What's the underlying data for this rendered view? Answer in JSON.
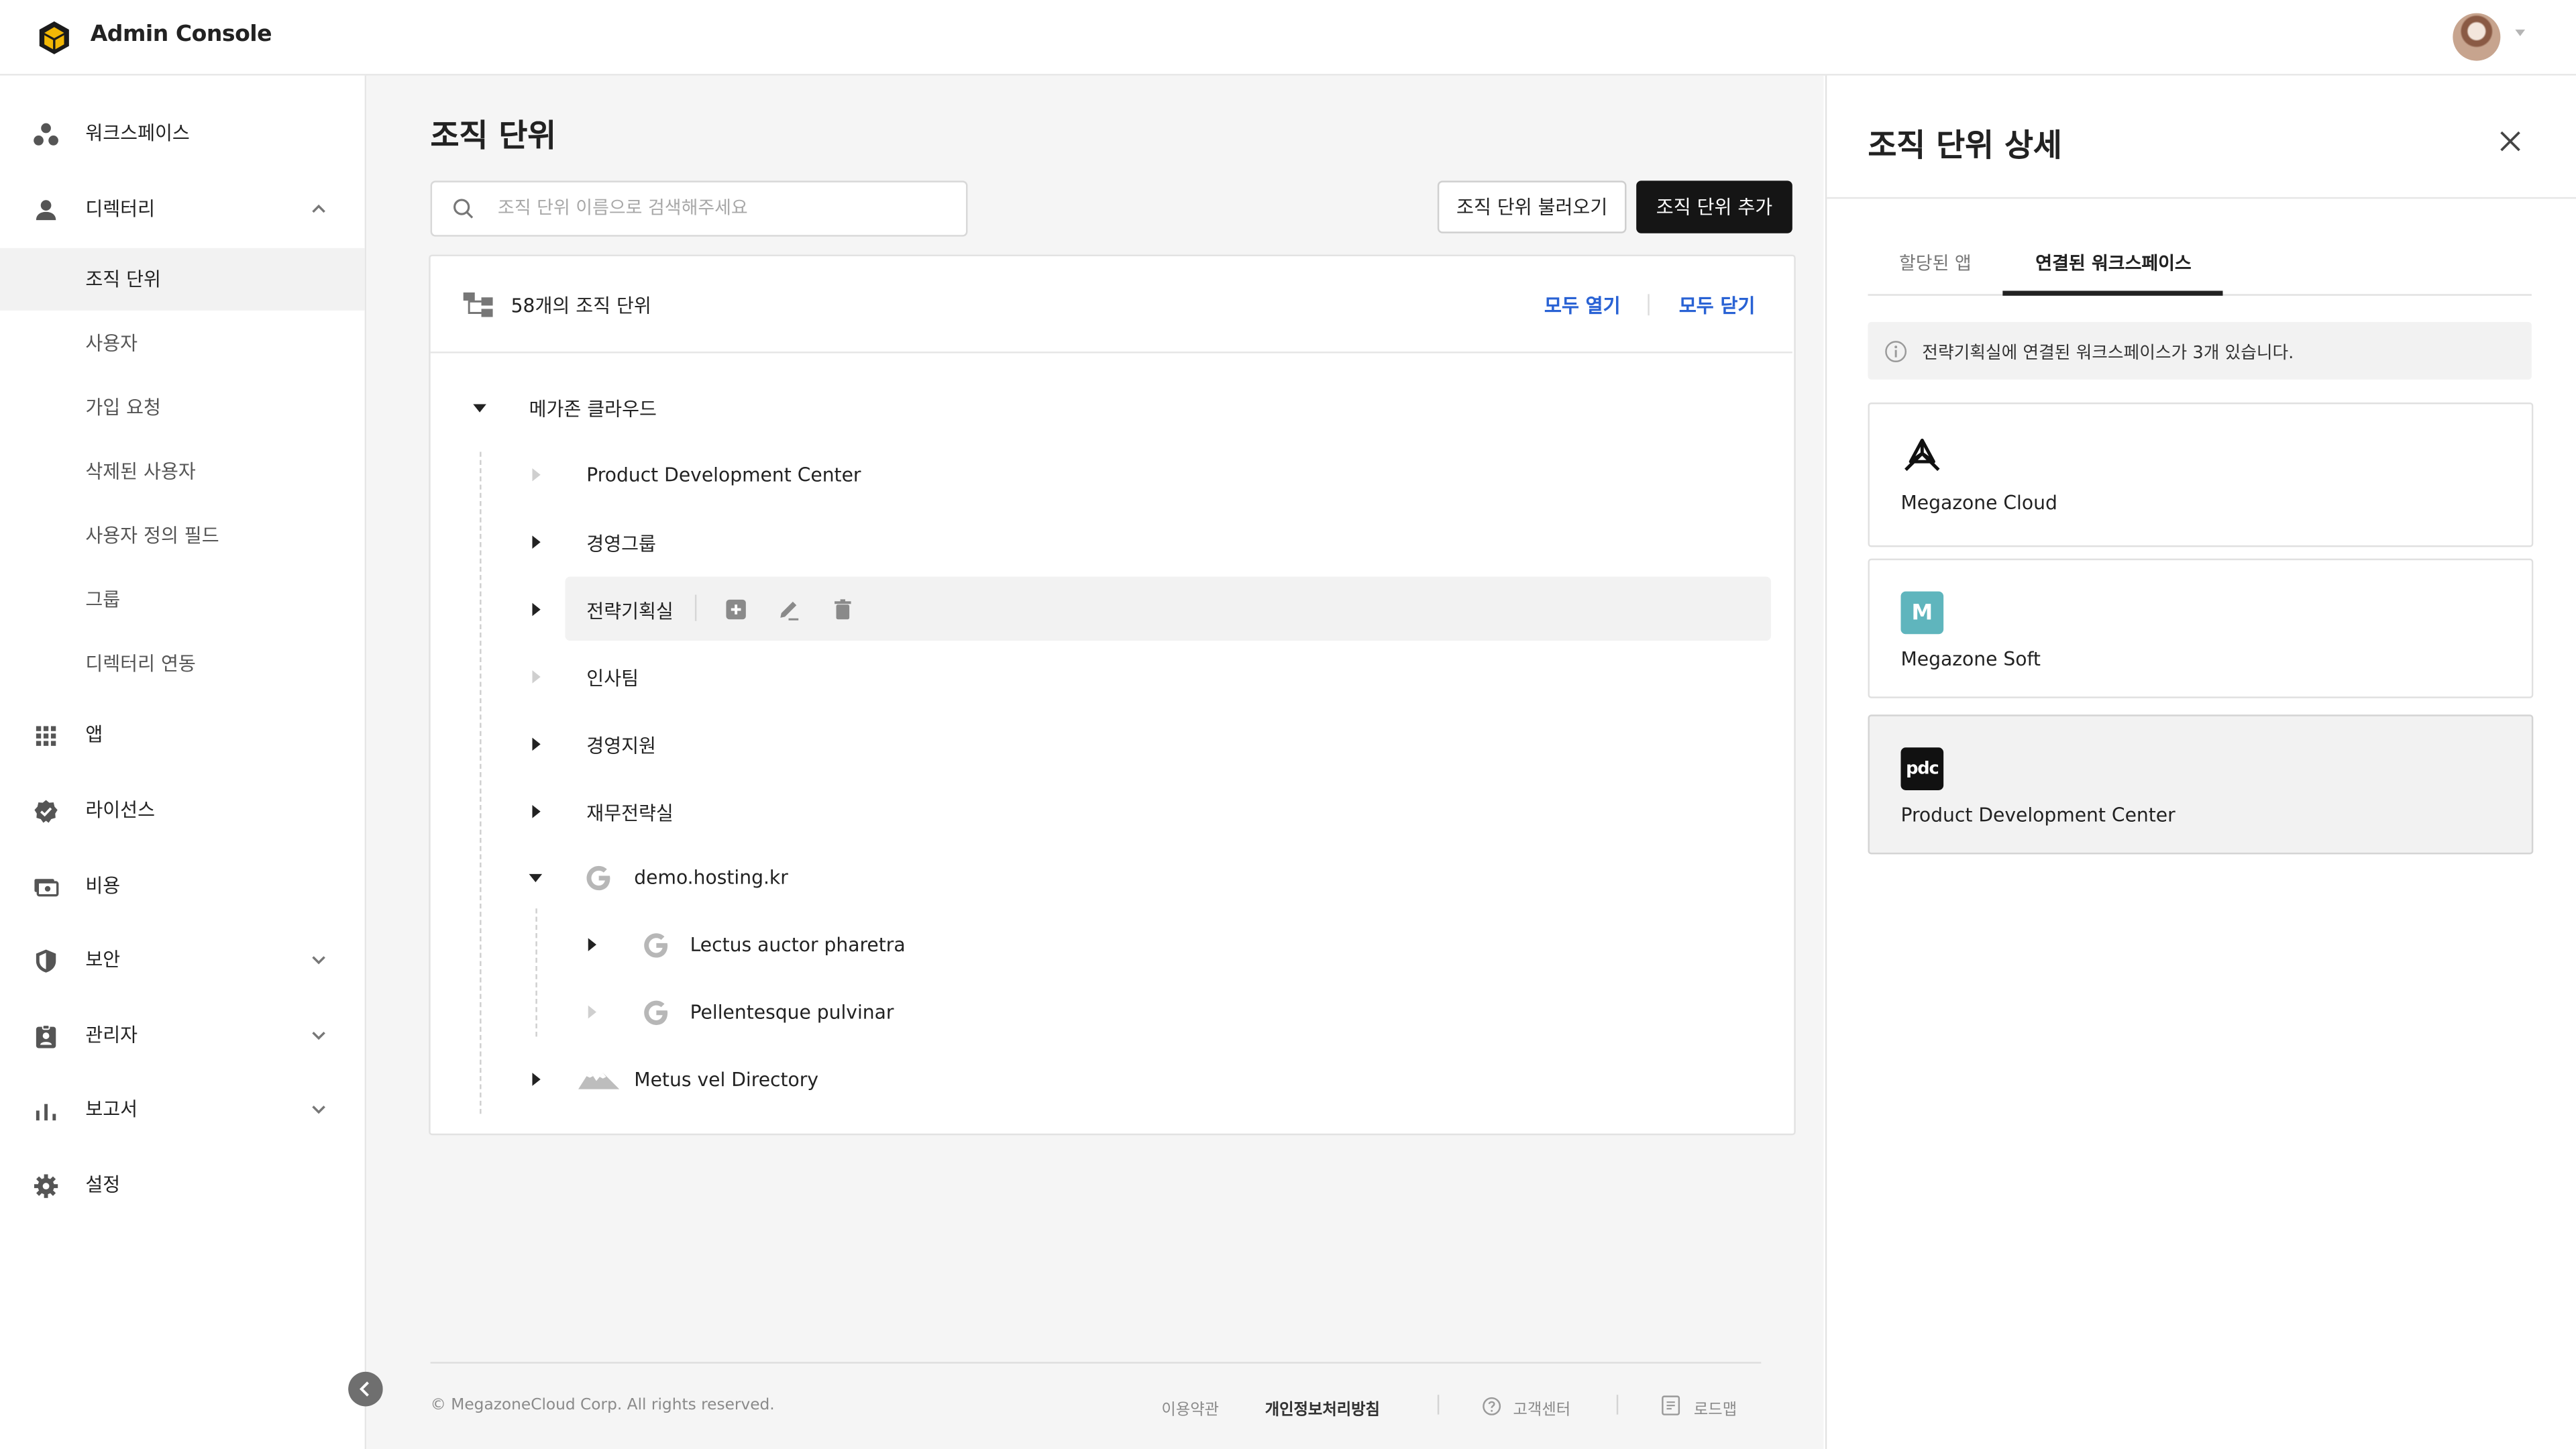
{
  "header": {
    "title": "Admin Console",
    "logo_icon": "megazone-cube-logo",
    "avatar_icon": "user-avatar"
  },
  "sidebar": {
    "items": [
      {
        "label": "워크스페이스",
        "icon": "workspace-icon"
      },
      {
        "label": "디렉터리",
        "icon": "person-icon",
        "expanded": true,
        "children": [
          "조직 단위",
          "사용자",
          "가입 요청",
          "삭제된 사용자",
          "사용자 정의 필드",
          "그룹",
          "디렉터리 연동"
        ],
        "active_child": "조직 단위"
      },
      {
        "label": "앱",
        "icon": "apps-grid-icon"
      },
      {
        "label": "라이선스",
        "icon": "badge-check-icon"
      },
      {
        "label": "비용",
        "icon": "billing-icon"
      },
      {
        "label": "보안",
        "icon": "shield-icon",
        "expandable": true
      },
      {
        "label": "관리자",
        "icon": "admin-id-icon",
        "expandable": true
      },
      {
        "label": "보고서",
        "icon": "bar-chart-icon",
        "expandable": true
      },
      {
        "label": "설정",
        "icon": "gear-icon"
      }
    ]
  },
  "main": {
    "title": "조직 단위",
    "search_placeholder": "조직 단위 이름으로 검색해주세요",
    "search_value": "",
    "import_button": "조직 단위 불러오기",
    "add_button": "조직 단위 추가",
    "tree": {
      "count_label": "58개의 조직 단위",
      "expand_all": "모두 열기",
      "collapse_all": "모두 닫기",
      "root": "메가존 클라우드",
      "nodes": [
        {
          "label": "Product Development Center",
          "has_children": false
        },
        {
          "label": "경영그룹",
          "has_children": true
        },
        {
          "label": "전략기획실",
          "has_children": true,
          "selected": true
        },
        {
          "label": "인사팀",
          "has_children": false
        },
        {
          "label": "경영지원",
          "has_children": true
        },
        {
          "label": "재무전략실",
          "has_children": true
        },
        {
          "label": "demo.hosting.kr",
          "has_children": true,
          "expanded": true,
          "icon": "google-icon",
          "children": [
            {
              "label": "Lectus auctor pharetra",
              "has_children": true,
              "icon": "google-icon"
            },
            {
              "label": "Pellentesque pulvinar",
              "has_children": false,
              "icon": "google-icon"
            }
          ]
        },
        {
          "label": "Metus vel Directory",
          "has_children": true,
          "icon": "mountain-directory-icon"
        }
      ]
    }
  },
  "footer": {
    "copyright": "© MegazoneCloud Corp. All rights reserved.",
    "terms": "이용약관",
    "privacy": "개인정보처리방침",
    "support": "고객센터",
    "roadmap": "로드맵"
  },
  "panel": {
    "title": "조직 단위 상세",
    "tabs": [
      "할당된 앱",
      "연결된 워크스페이스"
    ],
    "active_tab": "연결된 워크스페이스",
    "info": "전략기획실에 연결된 워크스페이스가 3개 있습니다.",
    "workspaces": [
      {
        "name": "Megazone Cloud",
        "logo": "megazone-cloud-logo"
      },
      {
        "name": "Megazone Soft",
        "logo_letter": "M",
        "logo_color": "#5fb5bd"
      },
      {
        "name": "Product Development Center",
        "logo_text": "pdc",
        "logo_color": "#111111",
        "selected": true
      }
    ]
  },
  "colors": {
    "accent_link": "#2962d4",
    "primary_button": "#151515",
    "main_bg": "#f5f5f5",
    "highlight_row": "#f2f2f2"
  }
}
